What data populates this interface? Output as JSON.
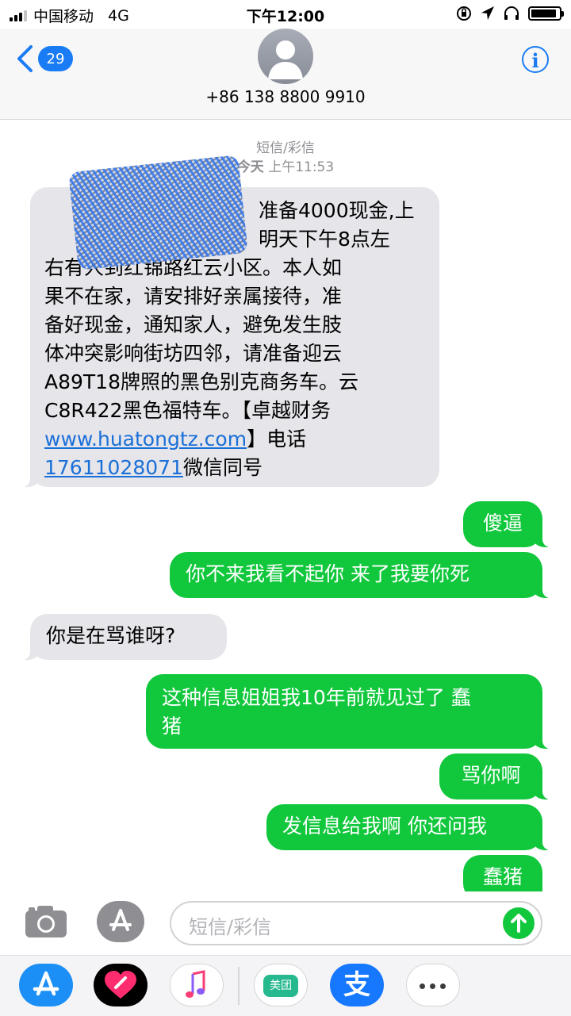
{
  "status_bar": {
    "carrier": "中国移动",
    "network": "4G",
    "time": "下午12:00",
    "signal_bars_filled": 3,
    "signal_bars_total": 4,
    "icons": [
      "orientation-lock-icon",
      "location-arrow-icon",
      "headphones-icon",
      "battery-icon"
    ],
    "battery_level": 0.9
  },
  "header": {
    "back_count": "29",
    "contact": "+86 138 8800 9910",
    "avatar_icon": "person-silhouette-icon",
    "info_icon": "i"
  },
  "conversation": {
    "service_label": "短信/彩信",
    "date_label": "今天",
    "time_label": "上午11:53",
    "messages": [
      {
        "direction": "incoming",
        "lines": [
          "准备4000现金,上",
          "明天下午8点左",
          "右有人到红锦路红云小区。本人如",
          "果不在家，请安排好亲属接待，准",
          "备好现金，通知家人，避免发生肢",
          "体冲突影响街坊四邻，请准备迎云",
          "A89T18牌照的黑色别克商务车。云",
          "C8R422黑色福特车。【卓越财务"
        ],
        "link_url": "www.huatongtz.com",
        "after_link": "】电话",
        "phone": "17611028071",
        "after_phone": "微信同号",
        "redacted": true
      },
      {
        "direction": "outgoing",
        "text": "傻逼"
      },
      {
        "direction": "outgoing",
        "text": "你不来我看不起你 来了我要你死"
      },
      {
        "direction": "incoming",
        "text": "你是在骂谁呀?"
      },
      {
        "direction": "outgoing",
        "lines": [
          "这种信息姐姐我10年前就见过了 蠢",
          "猪"
        ]
      },
      {
        "direction": "outgoing",
        "text": "骂你啊"
      },
      {
        "direction": "outgoing",
        "text": "发信息给我啊 你还问我"
      },
      {
        "direction": "outgoing",
        "text": "蠢猪"
      }
    ]
  },
  "compose": {
    "placeholder": "短信/彩信",
    "camera_icon": "camera-icon",
    "apps_icon": "app-store-icon",
    "send_icon": "send-arrow-icon"
  },
  "app_drawer": {
    "apps": [
      "app-store-icon",
      "digital-touch-icon",
      "music-icon",
      "meituan-icon",
      "alipay-icon",
      "more-icon"
    ],
    "meituan_label": "美团",
    "alipay_glyph": "支"
  },
  "colors": {
    "accent_blue": "#1a7cf5",
    "outgoing_green": "#11c73c",
    "incoming_gray": "#e5e5ea",
    "link_blue": "#1a6fd8"
  }
}
